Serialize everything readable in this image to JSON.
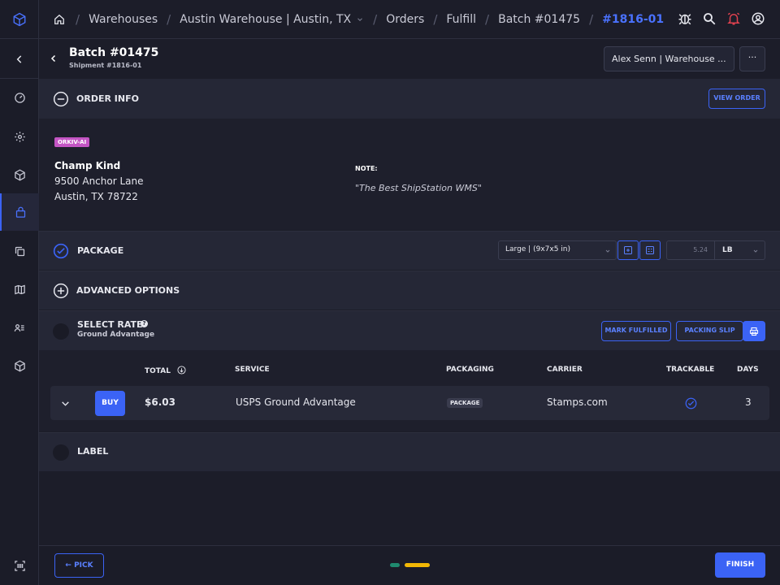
{
  "breadcrumb": {
    "items": [
      "Warehouses",
      "Austin Warehouse | Austin, TX",
      "Orders",
      "Fulfill",
      "Batch #01475"
    ],
    "current": "#1816-01"
  },
  "header": {
    "title": "Batch #01475",
    "subtitle": "Shipment #1816-01",
    "user_select": "Alex Senn | Warehouse ...",
    "more_label": "···"
  },
  "order_info": {
    "title": "ORDER INFO",
    "view_order_label": "VIEW ORDER",
    "source_badge": "ORKIV-AI",
    "customer_name": "Champ Kind",
    "address_line1": "9500 Anchor Lane",
    "address_line2": "Austin, TX 78722",
    "note_label": "NOTE:",
    "note_text": "\"The Best ShipStation WMS\""
  },
  "package": {
    "title": "PACKAGE",
    "box_select": "Large | (9x7x5 in)",
    "weight": "5.24",
    "unit": "LB"
  },
  "advanced": {
    "title": "ADVANCED OPTIONS"
  },
  "select_rate": {
    "title": "SELECT RATE",
    "subtitle": "Ground Advantage",
    "mark_fulfilled_label": "MARK FULFILLED",
    "packing_slip_label": "PACKING SLIP"
  },
  "rates_table": {
    "columns": [
      "TOTAL",
      "SERVICE",
      "PACKAGING",
      "CARRIER",
      "TRACKABLE",
      "DAYS"
    ],
    "rows": [
      {
        "buy_label": "BUY",
        "total": "$6.03",
        "service": "USPS Ground Advantage",
        "packaging": "PACKAGE",
        "carrier": "Stamps.com",
        "trackable": true,
        "days": "3"
      }
    ]
  },
  "label_section": {
    "title": "LABEL"
  },
  "footer": {
    "pick_label": "PICK",
    "finish_label": "FINISH",
    "progress_step_colors": [
      "#1f8a6f",
      "#f2b705"
    ]
  },
  "colors": {
    "accent": "#3b63f5",
    "badge_pink": "#c455c4",
    "alert_red": "#e0414f"
  }
}
